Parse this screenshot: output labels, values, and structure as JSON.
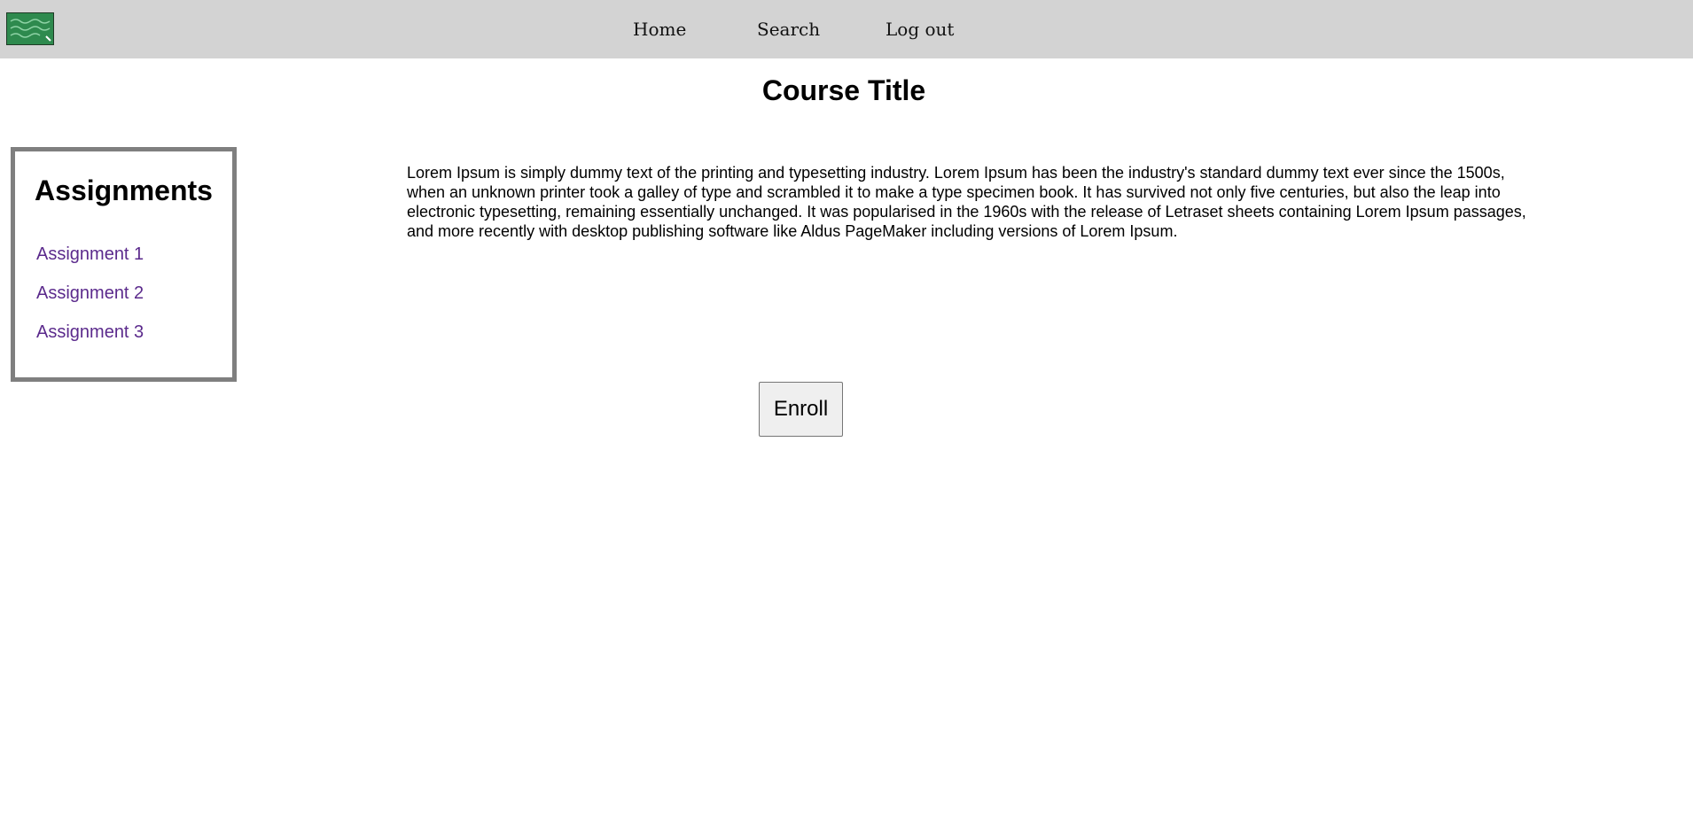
{
  "nav": {
    "logo_icon": "chalkboard-icon",
    "home": "Home",
    "search": "Search",
    "logout": "Log out"
  },
  "course": {
    "title": "Course Title",
    "description": "Lorem Ipsum is simply dummy text of the printing and typesetting industry. Lorem Ipsum has been the industry's standard dummy text ever since the 1500s, when an unknown printer took a galley of type and scrambled it to make a type specimen book. It has survived not only five centuries, but also the leap into electronic typesetting, remaining essentially unchanged. It was popularised in the 1960s with the release of Letraset sheets containing Lorem Ipsum passages, and more recently with desktop publishing software like Aldus PageMaker including versions of Lorem Ipsum."
  },
  "assignments": {
    "heading": "Assignments",
    "items": [
      {
        "label": "Assignment 1"
      },
      {
        "label": "Assignment 2"
      },
      {
        "label": "Assignment 3"
      }
    ]
  },
  "actions": {
    "enroll": "Enroll"
  },
  "colors": {
    "topbar": "#d3d3d3",
    "logo_green": "#2e8a4e",
    "link": "#5b2a8c",
    "box_border": "#7f7f7f"
  }
}
